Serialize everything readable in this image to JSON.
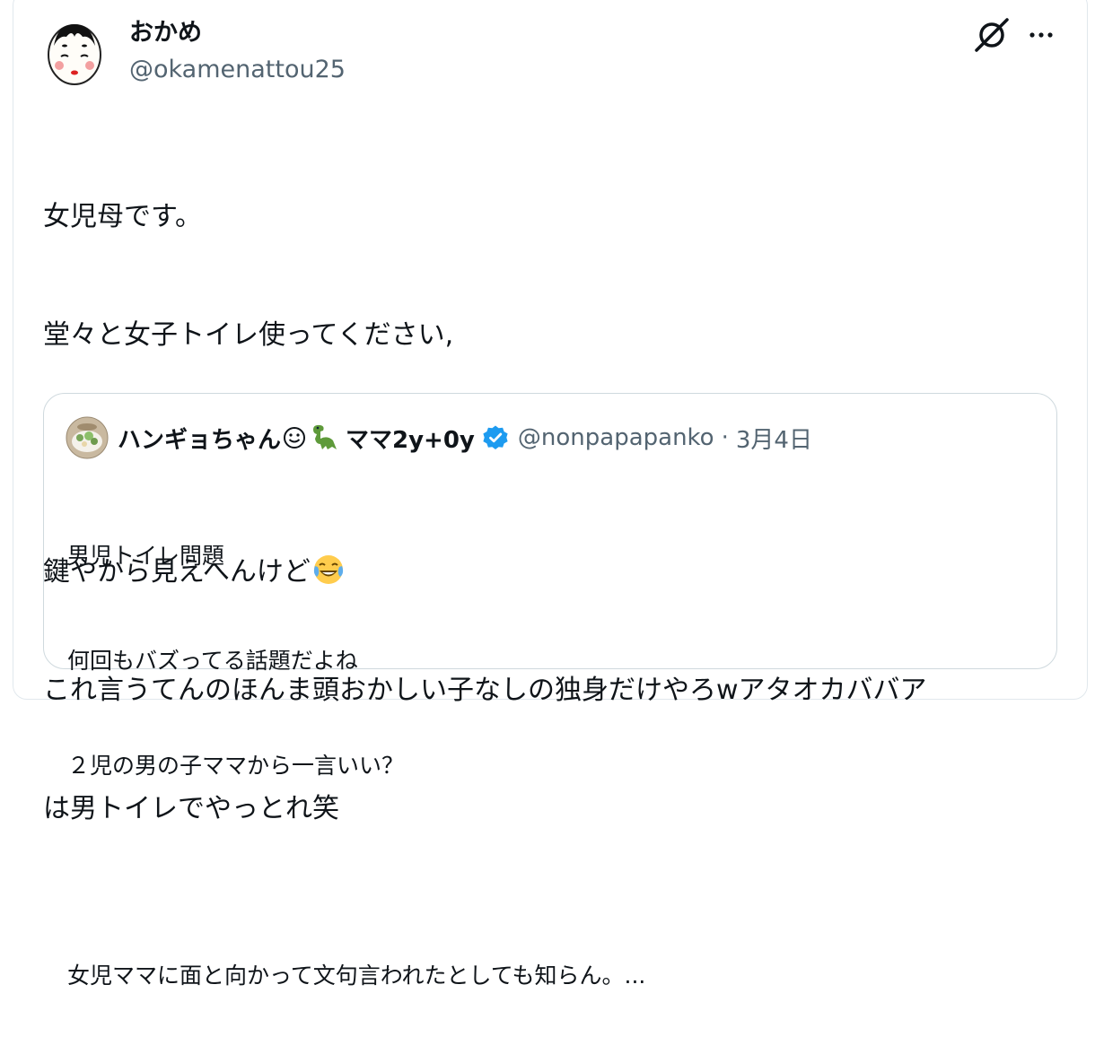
{
  "author": {
    "display_name": "おかめ",
    "handle": "@okamenattou25"
  },
  "icons": {
    "avatar": "okame-mask-avatar",
    "grok": "grok-icon",
    "more": "more-icon",
    "laugh_emoji": "tears-of-joy-emoji",
    "verified": "verified-badge-icon"
  },
  "tweet": {
    "lines": [
      "女児母です。",
      "堂々と女子トイレ使ってください,",
      "",
      "鍵やから見えへんけど",
      "これ言うてんのほんま頭おかしい子なしの独身だけやろwアタオカババア",
      "は男トイレでやっとれ笑"
    ]
  },
  "quote": {
    "display_name_part1": "ハンギョちゃん",
    "display_name_part2": "ママ2y+0y",
    "handle": "@nonpapapanko",
    "separator": "·",
    "date": "3月4日",
    "lines": [
      "男児トイレ問題",
      "何回もバズってる話題だよね",
      "２児の男の子ママから一言いい？",
      "",
      "女児ママに面と向かって文句言われたとしても知らん。..."
    ]
  },
  "colors": {
    "text": "#0f1419",
    "secondary": "#536471",
    "border": "#cfd9de",
    "verified": "#1d9bf0"
  }
}
